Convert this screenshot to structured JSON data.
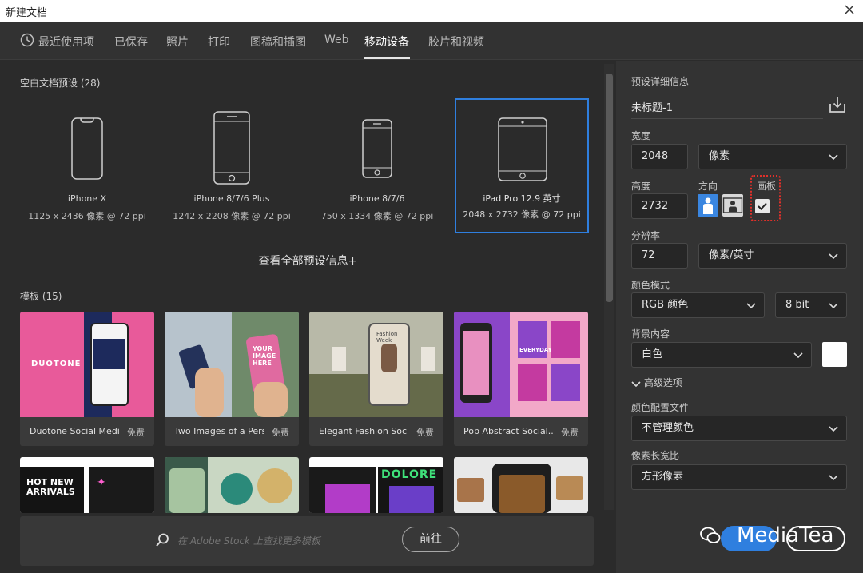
{
  "window": {
    "title": "新建文档"
  },
  "tabs": [
    {
      "label": "最近使用项"
    },
    {
      "label": "已保存"
    },
    {
      "label": "照片"
    },
    {
      "label": "打印"
    },
    {
      "label": "图稿和插图"
    },
    {
      "label": "Web"
    },
    {
      "label": "移动设备"
    },
    {
      "label": "胶片和视频"
    }
  ],
  "blank_presets": {
    "title": "空白文档预设",
    "count": "(28)",
    "items": [
      {
        "name": "iPhone X",
        "dims": "1125 x 2436 像素 @ 72 ppi"
      },
      {
        "name": "iPhone 8/7/6 Plus",
        "dims": "1242 x 2208 像素 @ 72 ppi"
      },
      {
        "name": "iPhone 8/7/6",
        "dims": "750 x 1334 像素 @ 72 ppi"
      },
      {
        "name": "iPad Pro 12.9 英寸",
        "dims": "2048 x 2732 像素 @ 72 ppi"
      }
    ],
    "view_all": "查看全部预设信息+"
  },
  "templates": {
    "title": "模板",
    "count": "(15)",
    "items": [
      {
        "label": "Duotone Social Medi...",
        "price": "免费",
        "art": "DUOTONE"
      },
      {
        "label": "Two Images of a Pers...",
        "price": "免费",
        "art": "YOUR IMAGE HERE"
      },
      {
        "label": "Elegant Fashion Soci...",
        "price": "免费",
        "art": "Fashion Week"
      },
      {
        "label": "Pop Abstract Social...",
        "price": "免费",
        "art": "EVERYDAY"
      }
    ],
    "row2_art": [
      "HOT NEW ARRIVALS",
      "",
      "DOLORE",
      ""
    ]
  },
  "stock": {
    "placeholder": "在 Adobe Stock 上查找更多模板",
    "go_label": "前往"
  },
  "details": {
    "title": "预设详细信息",
    "doc_name": "未标题-1",
    "width_label": "宽度",
    "width_value": "2048",
    "width_unit": "像素",
    "height_label": "高度",
    "height_value": "2732",
    "orientation_label": "方向",
    "artboard_label": "画板",
    "resolution_label": "分辨率",
    "resolution_value": "72",
    "resolution_unit": "像素/英寸",
    "color_mode_label": "颜色模式",
    "color_mode_value": "RGB 颜色",
    "bit_depth": "8 bit",
    "background_label": "背景内容",
    "background_value": "白色",
    "advanced_label": "高级选项",
    "color_profile_label": "颜色配置文件",
    "color_profile_value": "不管理颜色",
    "pixel_aspect_label": "像素长宽比",
    "pixel_aspect_value": "方形像素"
  },
  "watermark": {
    "text": "MediaTea"
  },
  "colors": {
    "accent": "#2f7fdf",
    "highlight": "#e0302a"
  }
}
